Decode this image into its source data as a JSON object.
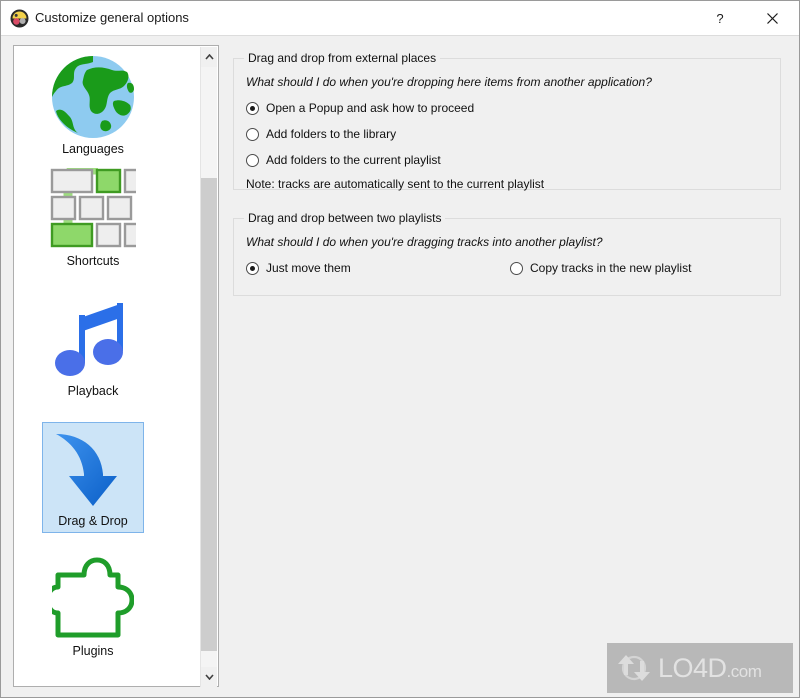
{
  "window": {
    "title": "Customize general options",
    "app_icon": "media-player-icon",
    "help_button": "?",
    "close_button": "×"
  },
  "sidebar": {
    "scrollbar": {
      "up_arrow": "chevron-up-icon",
      "down_arrow": "chevron-down-icon"
    },
    "items": [
      {
        "label": "Languages",
        "icon": "globe-icon",
        "selected": false
      },
      {
        "label": "Shortcuts",
        "icon": "keyboard-keys-icon",
        "selected": false
      },
      {
        "label": "Playback",
        "icon": "music-note-icon",
        "selected": false
      },
      {
        "label": "Drag & Drop",
        "icon": "curved-arrow-icon",
        "selected": true
      },
      {
        "label": "Plugins",
        "icon": "puzzle-piece-icon",
        "selected": false
      }
    ]
  },
  "main": {
    "groups": [
      {
        "title": "Drag and drop from external places",
        "question": "What should I do when you're dropping here items from another application?",
        "options": [
          {
            "label": "Open a Popup and ask how to proceed",
            "checked": true
          },
          {
            "label": "Add folders to the library",
            "checked": false
          },
          {
            "label": "Add folders to the current playlist",
            "checked": false
          }
        ],
        "note": "Note: tracks are automatically sent to the current playlist"
      },
      {
        "title": "Drag and drop between two playlists",
        "question": "What should I do when you're dragging tracks into another playlist?",
        "options": [
          {
            "label": "Just move them",
            "checked": true
          },
          {
            "label": "Copy tracks in the new playlist",
            "checked": false
          }
        ]
      }
    ]
  },
  "watermark": {
    "brand": "LO4D",
    "suffix": ".com",
    "icon": "recycle-arrows-icon"
  },
  "colors": {
    "dialog_bg": "#f0f0f0",
    "titlebar_bg": "#ffffff",
    "selection_bg": "#cce4f7",
    "selection_border": "#7eb4ea",
    "accent_green": "#1f9d1f",
    "accent_blue": "#2b7fe0",
    "scrollbar_thumb": "#cdcdcd"
  }
}
